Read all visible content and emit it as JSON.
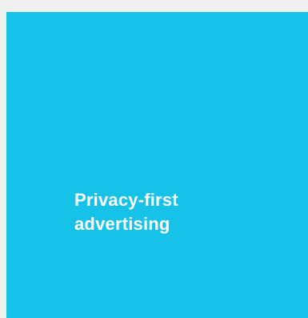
{
  "page": {
    "background_color": "#efefef"
  },
  "card": {
    "background_color": "#16c2e8",
    "text_color": "#ffffff",
    "title_lines": [
      "Privacy-first",
      "advertising"
    ]
  }
}
